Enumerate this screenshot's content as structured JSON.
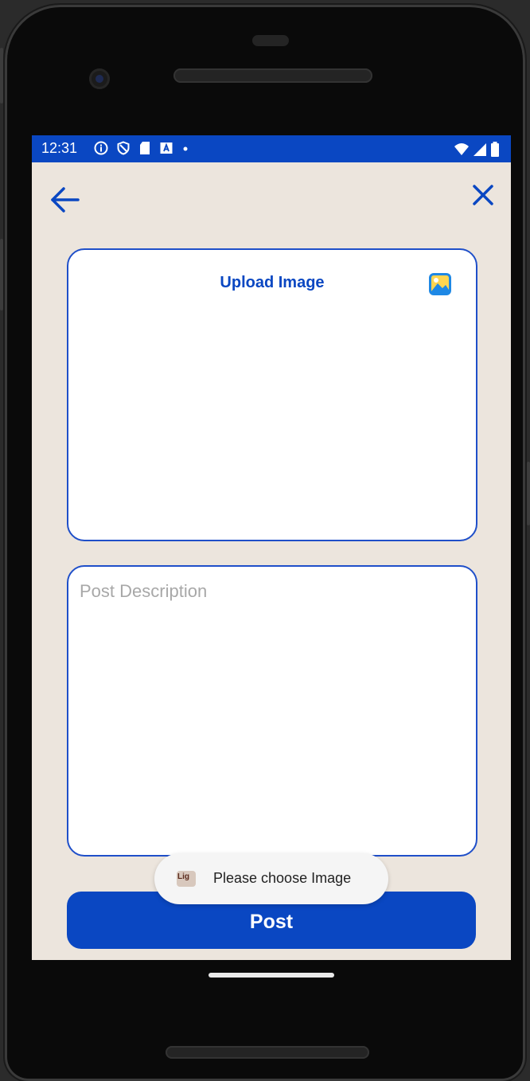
{
  "status_bar": {
    "time": "12:31",
    "icons": [
      "info-icon",
      "shield-icon",
      "sd-card-icon",
      "a-box-icon",
      "dot-icon"
    ],
    "right_icons": [
      "wifi-icon",
      "signal-icon",
      "battery-icon"
    ],
    "color": "#0a47c2"
  },
  "nav": {
    "back_icon": "arrow-left-icon",
    "close_icon": "close-icon"
  },
  "upload": {
    "title": "Upload Image",
    "icon": "gallery-icon"
  },
  "description": {
    "placeholder": "Post Description",
    "value": ""
  },
  "post_button": {
    "label": "Post"
  },
  "toast": {
    "message": "Please choose Image"
  },
  "colors": {
    "accent": "#0a47c2",
    "background": "#ece5dd",
    "card": "#ffffff"
  }
}
